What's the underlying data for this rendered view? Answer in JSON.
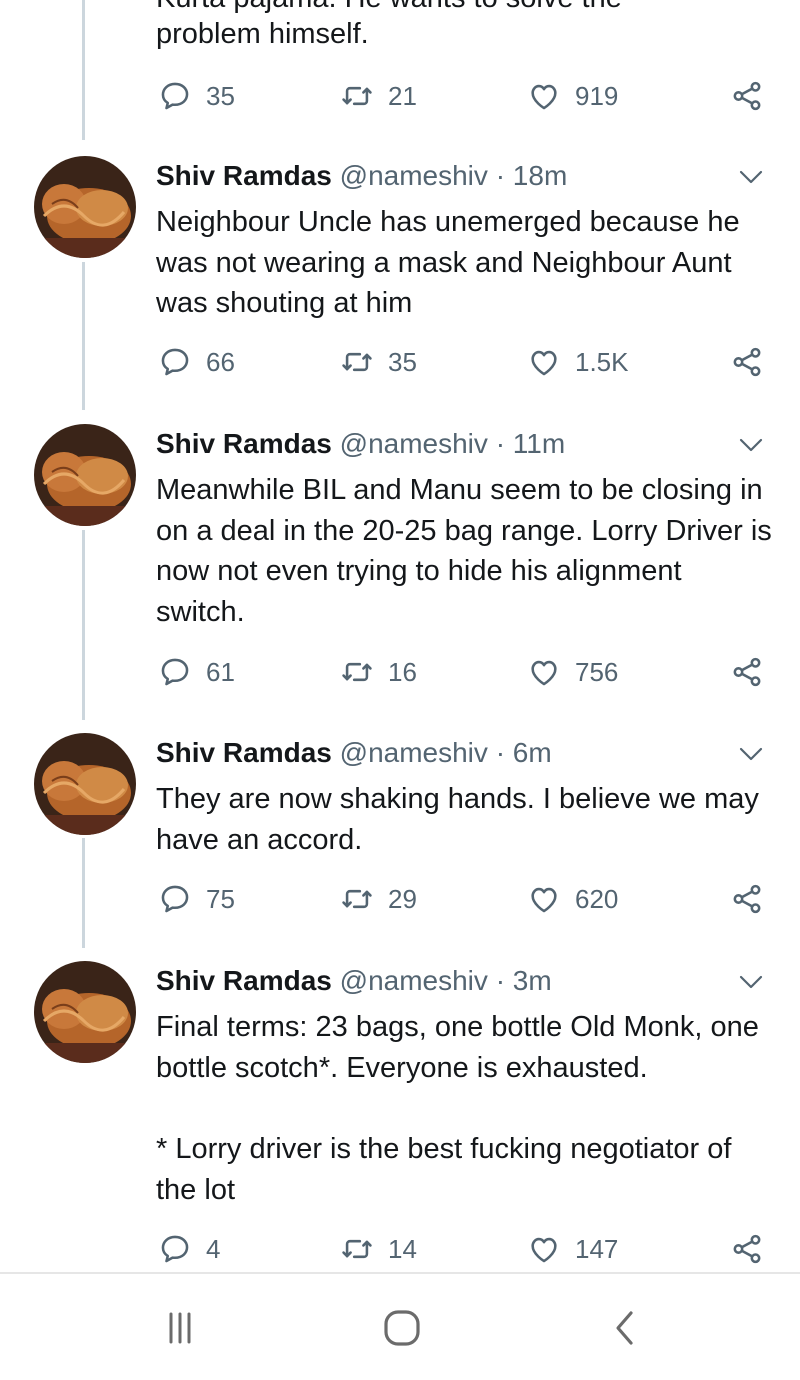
{
  "colors": {
    "text": "#14171a",
    "secondary": "#536471",
    "thread_line": "#ccd6dd",
    "icon": "#536471"
  },
  "partial_tweet": {
    "cut_text": "Kurta pajama. He wants to solve the",
    "text": "problem himself.",
    "reply_count": "35",
    "retweet_count": "21",
    "like_count": "919"
  },
  "tweets": [
    {
      "name": "Shiv Ramdas",
      "handle": "@nameshiv",
      "separator": "·",
      "time": "18m",
      "text": "Neighbour Uncle has unemerged because he was not wearing a mask and Neighbour Aunt was shouting at him",
      "reply_count": "66",
      "retweet_count": "35",
      "like_count": "1.5K"
    },
    {
      "name": "Shiv Ramdas",
      "handle": "@nameshiv",
      "separator": "·",
      "time": "11m",
      "text": "Meanwhile BIL and Manu seem to be closing in on a deal in the 20-25 bag range. Lorry Driver is now not even trying to hide his alignment switch.",
      "reply_count": "61",
      "retweet_count": "16",
      "like_count": "756"
    },
    {
      "name": "Shiv Ramdas",
      "handle": "@nameshiv",
      "separator": "·",
      "time": "6m",
      "text": "They are now shaking hands. I believe we may have an accord.",
      "reply_count": "75",
      "retweet_count": "29",
      "like_count": "620"
    },
    {
      "name": "Shiv Ramdas",
      "handle": "@nameshiv",
      "separator": "·",
      "time": "3m",
      "text": "Final terms: 23 bags, one bottle Old Monk, one bottle scotch*. Everyone is exhausted.",
      "text_footnote": "* Lorry driver is the best fucking negotiator of the lot",
      "reply_count": "4",
      "retweet_count": "14",
      "like_count": "147"
    }
  ],
  "icons": {
    "reply": "reply-icon",
    "retweet": "retweet-icon",
    "like": "heart-icon",
    "share": "share-icon",
    "caret": "chevron-down-icon"
  },
  "navbar": {
    "recent": "recent-apps-icon",
    "home": "home-icon",
    "back": "back-icon"
  }
}
